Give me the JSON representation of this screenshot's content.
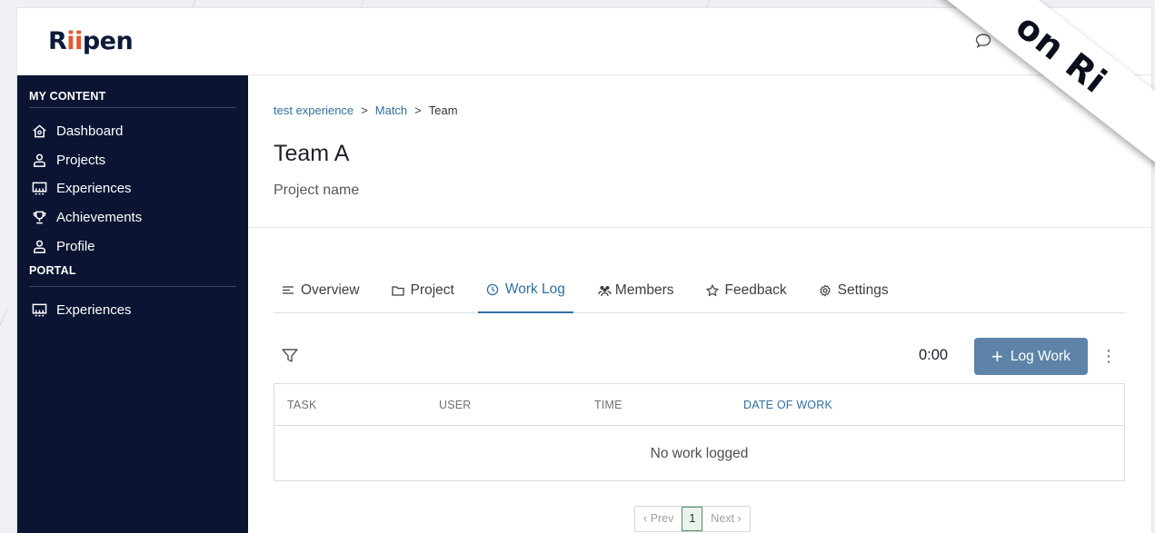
{
  "brand": {
    "logo_text_pre": "R",
    "logo_dots": "ii",
    "logo_text_post": "pen",
    "dot_color": "#e4572e"
  },
  "topbar": {
    "icons": [
      "chat-icon",
      "inbox-icon"
    ]
  },
  "sidebar": {
    "sections": [
      {
        "title": "MY CONTENT",
        "items": [
          {
            "label": "Dashboard",
            "icon": "home-icon"
          },
          {
            "label": "Projects",
            "icon": "user-icon"
          },
          {
            "label": "Experiences",
            "icon": "board-icon"
          },
          {
            "label": "Achievements",
            "icon": "trophy-icon"
          },
          {
            "label": "Profile",
            "icon": "user-icon"
          }
        ]
      },
      {
        "title": "PORTAL",
        "items": [
          {
            "label": "Experiences",
            "icon": "board-icon"
          }
        ]
      }
    ]
  },
  "breadcrumb": {
    "items": [
      "test experience",
      "Match"
    ],
    "current": "Team",
    "separator": ">"
  },
  "page": {
    "title": "Team A",
    "subtitle": "Project name"
  },
  "tabs": [
    {
      "label": "Overview",
      "icon": "list-icon",
      "active": false
    },
    {
      "label": "Project",
      "icon": "folder-icon",
      "active": false
    },
    {
      "label": "Work Log",
      "icon": "clock-icon",
      "active": true
    },
    {
      "label": "Members",
      "icon": "group-icon",
      "active": false
    },
    {
      "label": "Feedback",
      "icon": "star-icon",
      "active": false
    },
    {
      "label": "Settings",
      "icon": "gear-icon",
      "active": false
    }
  ],
  "worklog": {
    "total_time": "0:00",
    "log_button": "Log Work",
    "columns": [
      "TASK",
      "USER",
      "TIME",
      "DATE OF WORK"
    ],
    "empty_message": "No work logged"
  },
  "pagination": {
    "prev": "‹ Prev",
    "page": "1",
    "next": "Next ›"
  },
  "ribbon": {
    "text": "on Ri"
  },
  "colors": {
    "sidebar_bg": "#0b1432",
    "accent": "#2f6fa5",
    "button_bg": "#5d84a8"
  }
}
